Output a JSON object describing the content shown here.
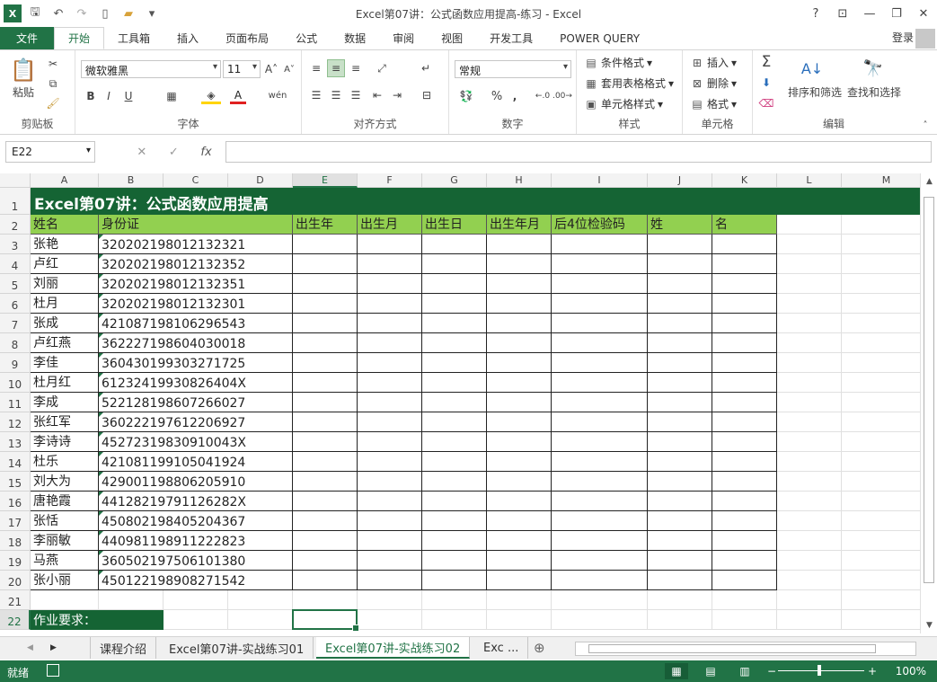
{
  "window": {
    "title": "Excel第07讲：公式函数应用提高-练习 - Excel",
    "help": "?",
    "minimize": "—",
    "restore": "❐",
    "close": "✕"
  },
  "tabs": {
    "file": "文件",
    "items": [
      "开始",
      "工具箱",
      "插入",
      "页面布局",
      "公式",
      "数据",
      "审阅",
      "视图",
      "开发工具",
      "POWER QUERY"
    ],
    "signin": "登录"
  },
  "ribbon": {
    "clipboard": {
      "label": "剪贴板",
      "paste": "粘贴"
    },
    "font": {
      "label": "字体",
      "name": "微软雅黑",
      "size": "11",
      "bold": "B",
      "italic": "I",
      "underline": "U",
      "wen": "wén"
    },
    "align": {
      "label": "对齐方式"
    },
    "number": {
      "label": "数字",
      "format": "常规",
      "percent": "%",
      "comma": ","
    },
    "styles": {
      "label": "样式",
      "conditional": "条件格式",
      "table": "套用表格格式",
      "cell": "单元格样式"
    },
    "cells": {
      "label": "单元格",
      "insert": "插入",
      "delete": "删除",
      "format": "格式"
    },
    "edit": {
      "label": "编辑",
      "sort": "排序和筛选",
      "find": "查找和选择",
      "sigma": "Σ"
    }
  },
  "formula_bar": {
    "name_box": "E22",
    "fx": "fx",
    "cancel": "✕",
    "enter": "✓",
    "value": ""
  },
  "columns": [
    "A",
    "B",
    "C",
    "D",
    "E",
    "F",
    "G",
    "H",
    "I",
    "J",
    "K",
    "L",
    "M"
  ],
  "selected_column": "E",
  "selected_row": "22",
  "rows": [
    "1",
    "2",
    "3",
    "4",
    "5",
    "6",
    "7",
    "8",
    "9",
    "10",
    "11",
    "12",
    "13",
    "14",
    "15",
    "16",
    "17",
    "18",
    "19",
    "20",
    "21",
    "22"
  ],
  "sheet": {
    "title": "Excel第07讲：公式函数应用提高",
    "headers": [
      "姓名",
      "身份证",
      "出生年",
      "出生月",
      "出生日",
      "出生年月",
      "后4位检验码",
      "姓",
      "名"
    ],
    "records": [
      [
        "张艳",
        "320202198012132321"
      ],
      [
        "卢红",
        "320202198012132352"
      ],
      [
        "刘丽",
        "320202198012132351"
      ],
      [
        "杜月",
        "320202198012132301"
      ],
      [
        "张成",
        "421087198106296543"
      ],
      [
        "卢红燕",
        "362227198604030018"
      ],
      [
        "李佳",
        "360430199303271725"
      ],
      [
        "杜月红",
        "61232419930826404X"
      ],
      [
        "李成",
        "522128198607266027"
      ],
      [
        "张红军",
        "360222197612206927"
      ],
      [
        "李诗诗",
        "45272319830910043X"
      ],
      [
        "杜乐",
        "421081199105041924"
      ],
      [
        "刘大为",
        "429001198806205910"
      ],
      [
        "唐艳霞",
        "44128219791126282X"
      ],
      [
        "张恬",
        "450802198405204367"
      ],
      [
        "李丽敏",
        "440981198911222823"
      ],
      [
        "马燕",
        "360502197506101380"
      ],
      [
        "张小丽",
        "450122198908271542"
      ]
    ],
    "homework_label": "作业要求："
  },
  "sheet_tabs": [
    "课程介绍",
    "Excel第07讲-实战练习01",
    "Excel第07讲-实战练习02",
    "Exc ..."
  ],
  "active_sheet_index": 2,
  "status": {
    "ready": "就绪",
    "zoom": "100%",
    "zoom_minus": "−",
    "zoom_plus": "+"
  },
  "colors": {
    "accent": "#217346",
    "title_fill": "#156434",
    "header_fill": "#92d050"
  }
}
